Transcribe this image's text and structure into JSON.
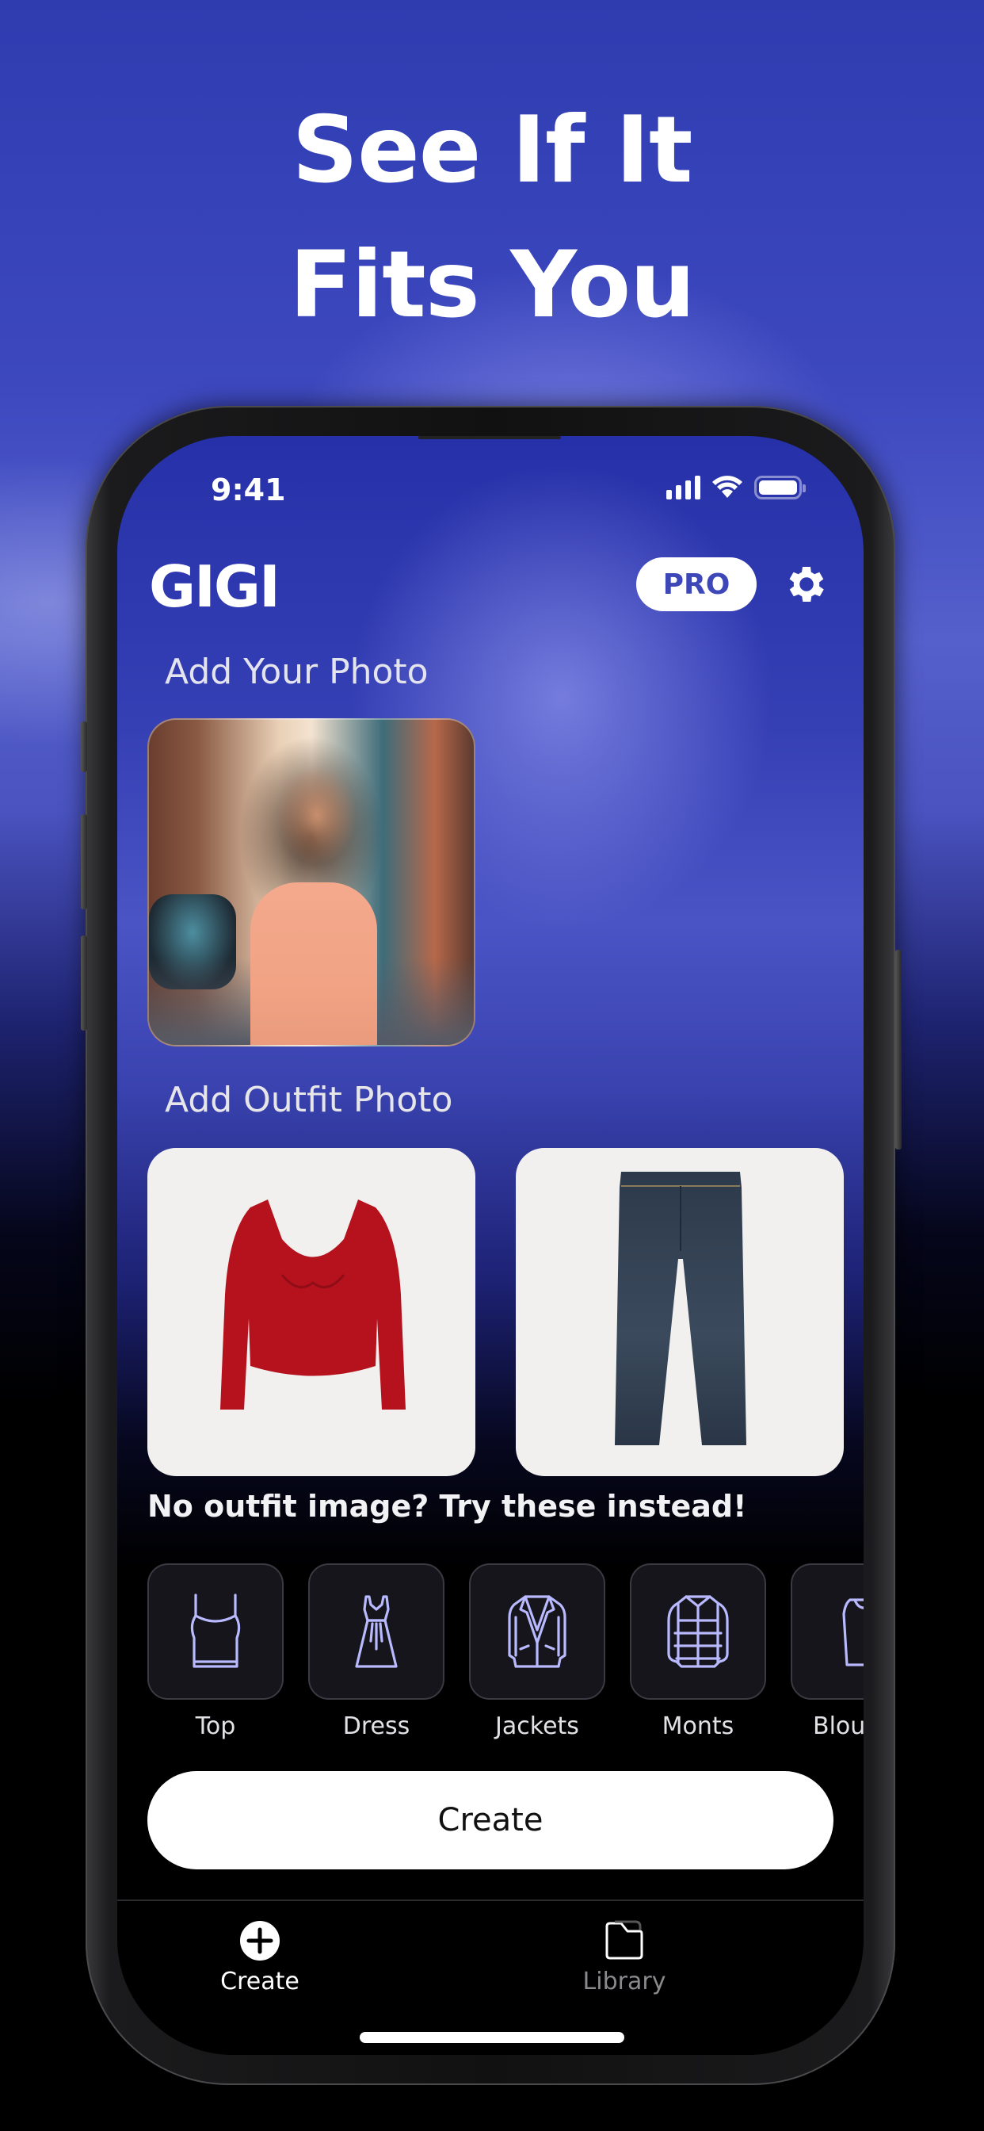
{
  "marketing": {
    "headline_line1": "See If It",
    "headline_line2": "Fits You"
  },
  "status_bar": {
    "time": "9:41",
    "icons": [
      "cellular-signal-icon",
      "wifi-icon",
      "battery-icon"
    ]
  },
  "header": {
    "app_title": "GIGI",
    "pro_label": "PRO",
    "settings_icon": "gear-icon"
  },
  "your_photo": {
    "section_label": "Add Your Photo",
    "image_description": "Smiling woman with curly hair in peach sleeveless dress on city street"
  },
  "outfit_photo": {
    "section_label": "Add Outfit Photo",
    "items": [
      {
        "description": "Red long-sleeve sweetheart-neck crop top"
      },
      {
        "description": "Dark wash straight-leg denim jeans"
      }
    ]
  },
  "suggestions": {
    "hint": "No outfit image? Try these instead!",
    "categories": [
      {
        "label": "Top",
        "icon": "tank-top-icon"
      },
      {
        "label": "Dress",
        "icon": "dress-icon"
      },
      {
        "label": "Jackets",
        "icon": "blazer-icon"
      },
      {
        "label": "Monts",
        "icon": "puffer-jacket-icon"
      },
      {
        "label": "Blouses",
        "icon": "blouse-icon"
      }
    ]
  },
  "actions": {
    "create_label": "Create"
  },
  "tab_bar": {
    "tabs": [
      {
        "label": "Create",
        "icon": "plus-circle-icon",
        "active": true
      },
      {
        "label": "Library",
        "icon": "folder-icon",
        "active": false
      }
    ]
  },
  "colors": {
    "accent": "#3d47b8",
    "icon_tint": "#b9b9ff",
    "tab_active": "#ffffff",
    "tab_inactive": "#8a8a8e"
  }
}
